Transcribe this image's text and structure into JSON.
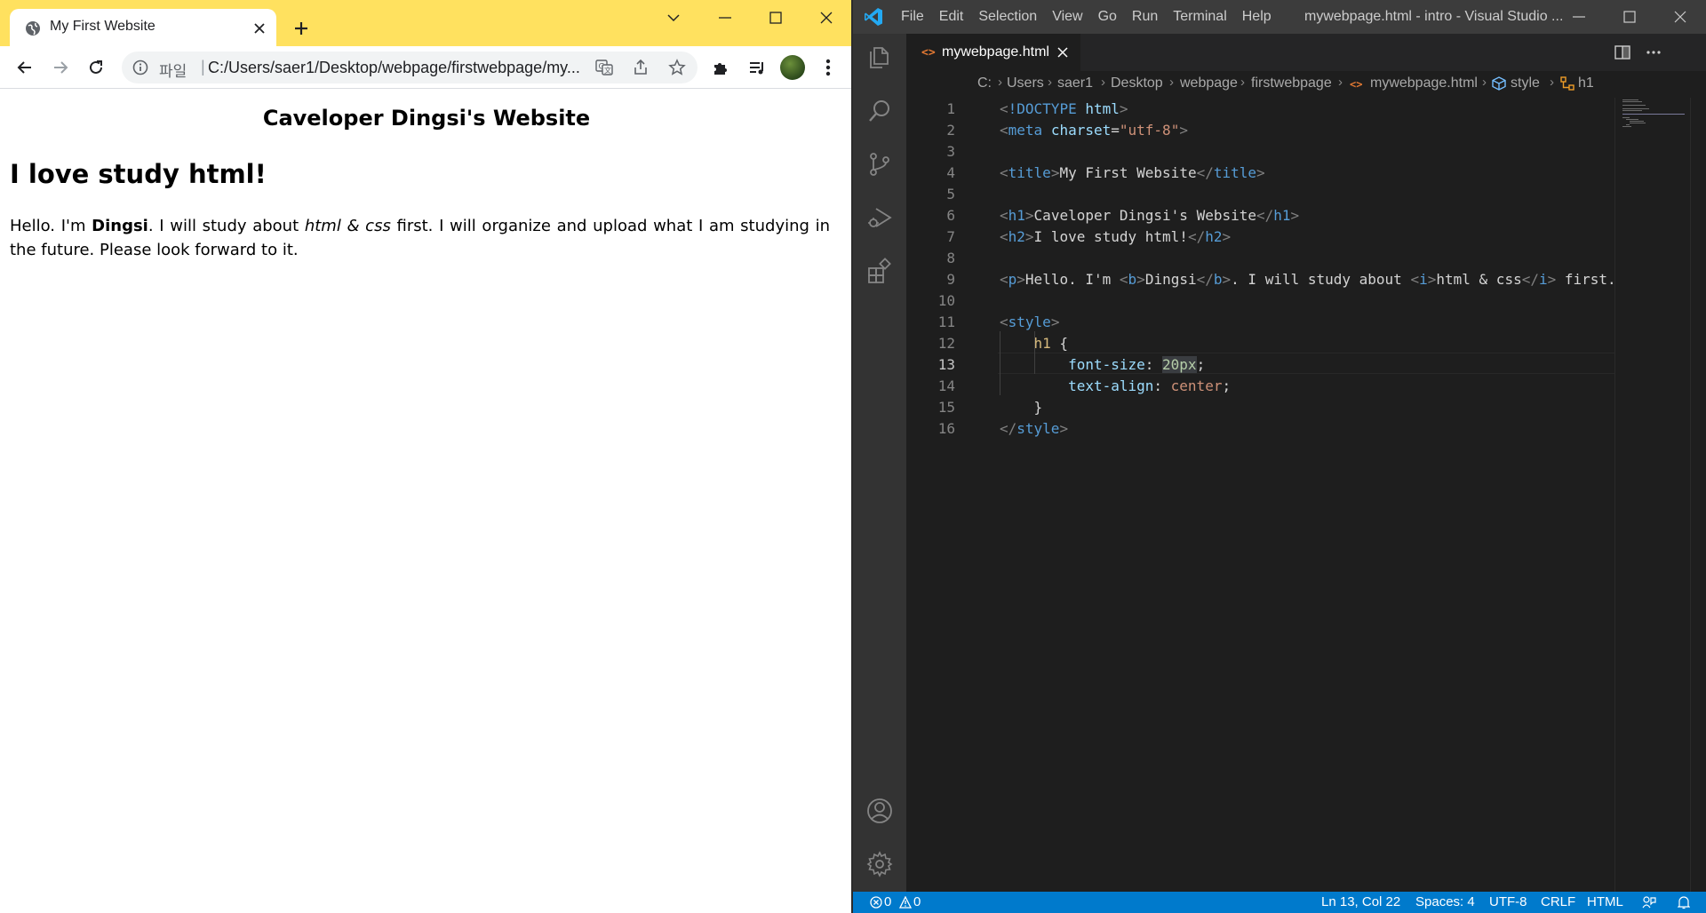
{
  "browser": {
    "tab_title": "My First Website",
    "address_scheme": "파일",
    "address_separator": "|",
    "address_url": "C:/Users/saer1/Desktop/webpage/firstwebpage/my...",
    "theme_color": "#ffe15f"
  },
  "webpage": {
    "h1": "Caveloper Dingsi's Website",
    "h2": "I love study html!",
    "p_start": "Hello. I'm ",
    "p_bold": "Dingsi",
    "p_mid": ". I will study about ",
    "p_italic": "html & css",
    "p_end": " first. I will organize and upload what I am studying in the future. Please look forward to it."
  },
  "vscode": {
    "menu": [
      "File",
      "Edit",
      "Selection",
      "View",
      "Go",
      "Run",
      "Terminal",
      "Help"
    ],
    "window_title": "mywebpage.html - intro - Visual Studio ...",
    "tab_label": "mywebpage.html",
    "breadcrumbs": [
      "C:",
      "Users",
      "saer1",
      "Desktop",
      "webpage",
      "firstwebpage",
      "mywebpage.html",
      "style",
      "h1"
    ],
    "line_numbers": [
      "1",
      "2",
      "3",
      "4",
      "5",
      "6",
      "7",
      "8",
      "9",
      "10",
      "11",
      "12",
      "13",
      "14",
      "15",
      "16"
    ],
    "active_line": 13,
    "status": {
      "errors": "0",
      "warnings": "0",
      "cursor": "Ln 13, Col 22",
      "spaces": "Spaces: 4",
      "encoding": "UTF-8",
      "eol": "CRLF",
      "language": "HTML"
    },
    "accent_color": "#007acc"
  }
}
